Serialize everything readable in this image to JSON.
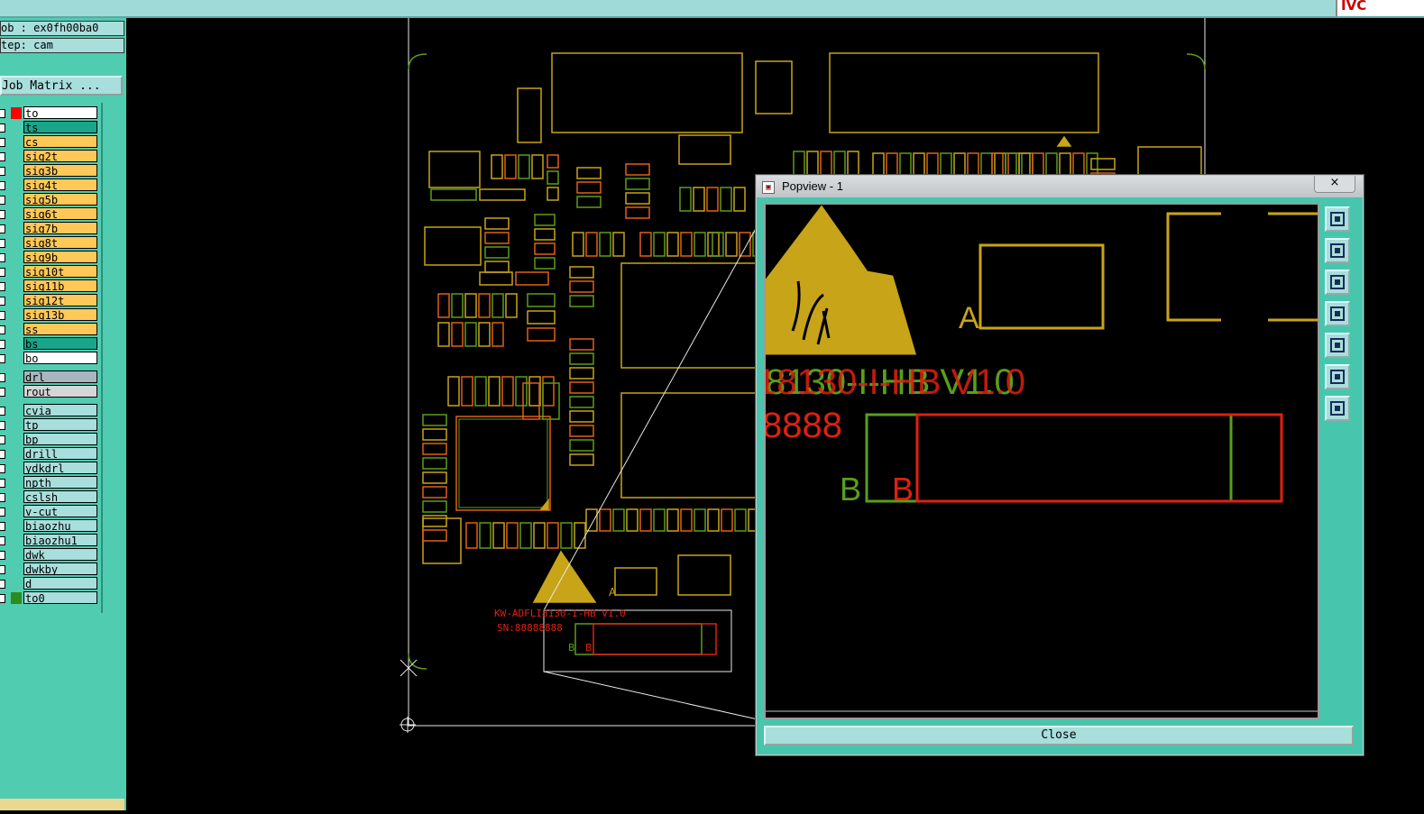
{
  "app": {
    "corner_text": "IVC"
  },
  "info": {
    "job": "ob : ex0fh00ba0",
    "step": "tep: cam"
  },
  "job_matrix_label": "Job Matrix ...",
  "layers": [
    {
      "name": "to",
      "bg": "#ffffff",
      "swatch": "#ff0000",
      "group": 1
    },
    {
      "name": "ts",
      "bg": "#1aa58a",
      "swatch": "",
      "group": 1
    },
    {
      "name": "cs",
      "bg": "#ffc857",
      "swatch": "",
      "group": 1
    },
    {
      "name": "sig2t",
      "bg": "#ffc857",
      "swatch": "",
      "group": 1
    },
    {
      "name": "sig3b",
      "bg": "#ffc857",
      "swatch": "",
      "group": 1
    },
    {
      "name": "sig4t",
      "bg": "#ffc857",
      "swatch": "",
      "group": 1
    },
    {
      "name": "sig5b",
      "bg": "#ffc857",
      "swatch": "",
      "group": 1
    },
    {
      "name": "sig6t",
      "bg": "#ffc857",
      "swatch": "",
      "group": 1
    },
    {
      "name": "sig7b",
      "bg": "#ffc857",
      "swatch": "",
      "group": 1
    },
    {
      "name": "sig8t",
      "bg": "#ffc857",
      "swatch": "",
      "group": 1
    },
    {
      "name": "sig9b",
      "bg": "#ffc857",
      "swatch": "",
      "group": 1
    },
    {
      "name": "sig10t",
      "bg": "#ffc857",
      "swatch": "",
      "group": 1
    },
    {
      "name": "sig11b",
      "bg": "#ffc857",
      "swatch": "",
      "group": 1
    },
    {
      "name": "sig12t",
      "bg": "#ffc857",
      "swatch": "",
      "group": 1
    },
    {
      "name": "sig13b",
      "bg": "#ffc857",
      "swatch": "",
      "group": 1
    },
    {
      "name": "ss",
      "bg": "#ffc857",
      "swatch": "",
      "group": 1
    },
    {
      "name": "bs",
      "bg": "#1aa58a",
      "swatch": "",
      "group": 1
    },
    {
      "name": "bo",
      "bg": "#ffffff",
      "swatch": "",
      "group": 1
    },
    {
      "name": "drl",
      "bg": "#a9b6be",
      "swatch": "",
      "group": 2
    },
    {
      "name": "rout",
      "bg": "#d6d6d6",
      "swatch": "",
      "group": 2
    },
    {
      "name": "cvia",
      "bg": "#a8dedc",
      "swatch": "",
      "group": 3
    },
    {
      "name": "tp",
      "bg": "#a8dedc",
      "swatch": "",
      "group": 3
    },
    {
      "name": "bp",
      "bg": "#a8dedc",
      "swatch": "",
      "group": 3
    },
    {
      "name": "drill",
      "bg": "#a8dedc",
      "swatch": "",
      "group": 3
    },
    {
      "name": "ydkdrl",
      "bg": "#a8dedc",
      "swatch": "",
      "group": 3
    },
    {
      "name": "npth",
      "bg": "#a8dedc",
      "swatch": "",
      "group": 3
    },
    {
      "name": "cslsh",
      "bg": "#a8dedc",
      "swatch": "",
      "group": 3
    },
    {
      "name": "v-cut",
      "bg": "#a8dedc",
      "swatch": "",
      "group": 3
    },
    {
      "name": "biaozhu",
      "bg": "#a8dedc",
      "swatch": "",
      "group": 3
    },
    {
      "name": "biaozhu1",
      "bg": "#a8dedc",
      "swatch": "",
      "group": 3
    },
    {
      "name": "dwk",
      "bg": "#a8dedc",
      "swatch": "",
      "group": 3
    },
    {
      "name": "dwkby",
      "bg": "#a8dedc",
      "swatch": "",
      "group": 3
    },
    {
      "name": "d",
      "bg": "#a8dedc",
      "swatch": "",
      "group": 3
    },
    {
      "name": "to0",
      "bg": "#a8dedc",
      "swatch": "#2e8b1e",
      "group": 3
    }
  ],
  "board": {
    "silk_line1": "KW-ADFLI8130-I-HB V1.0",
    "silk_line2": "SN:88888888",
    "label_a": "A",
    "label_b_green": "B",
    "label_b_red": "B"
  },
  "popview": {
    "title": "Popview - 1",
    "close_x": "×",
    "close_label": "Close",
    "text_green": "8130-I-HB V1.0",
    "text_red": "18130-I-HB V1.0",
    "text_sn": "8888",
    "label_a": "A",
    "label_b_green": "B",
    "label_b_red": "B",
    "toolbar_icons": [
      "window-icon",
      "layer-up-icon",
      "layer-down-icon",
      "panel-left-icon",
      "panel-right-icon",
      "fit-icon",
      "zoom-out-icon"
    ]
  },
  "colors": {
    "yellow": "#c8a418",
    "green": "#5a9e1a",
    "red": "#e02010",
    "orange": "#e06018",
    "white": "#e8e8e8"
  }
}
